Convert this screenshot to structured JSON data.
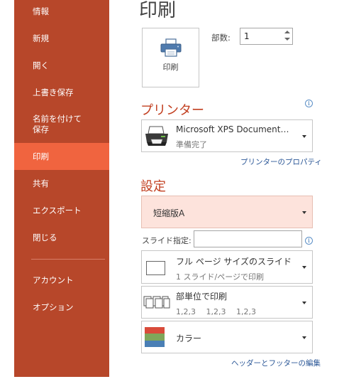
{
  "nav": {
    "items": [
      {
        "label": "情報"
      },
      {
        "label": "新規"
      },
      {
        "label": "開く"
      },
      {
        "label": "上書き保存"
      },
      {
        "label": "名前を付けて\n保存"
      },
      {
        "label": "印刷"
      },
      {
        "label": "共有"
      },
      {
        "label": "エクスポート"
      },
      {
        "label": "閉じる"
      },
      {
        "label": "アカウント"
      },
      {
        "label": "オプション"
      }
    ],
    "active_index": 5
  },
  "page_title": "印刷",
  "print_button": {
    "label": "印刷",
    "icon": "printer-icon"
  },
  "copies": {
    "label": "部数:",
    "value": "1"
  },
  "printer": {
    "heading": "プリンター",
    "name": "Microsoft XPS Document…",
    "status": "準備完了",
    "properties_link": "プリンターのプロパティ",
    "icon": "printer-icon"
  },
  "settings": {
    "heading": "設定",
    "selected_option": "短縮版A",
    "slides_label": "スライド指定:",
    "slides_value": "",
    "layout": {
      "title": "フル ページ サイズのスライド",
      "subtitle": "1 スライド/ページで印刷"
    },
    "collate": {
      "title": "部単位で印刷",
      "subtitle": "1,2,3　 1,2,3　 1,2,3"
    },
    "color": {
      "title": "カラー"
    },
    "header_footer_link": "ヘッダーとフッターの編集"
  },
  "colors": {
    "backstage": "#b7472a",
    "active_item": "#f0643f",
    "heading": "#c23f20",
    "highlight_dropdown": "#fde3dc",
    "link": "#2b5797"
  }
}
